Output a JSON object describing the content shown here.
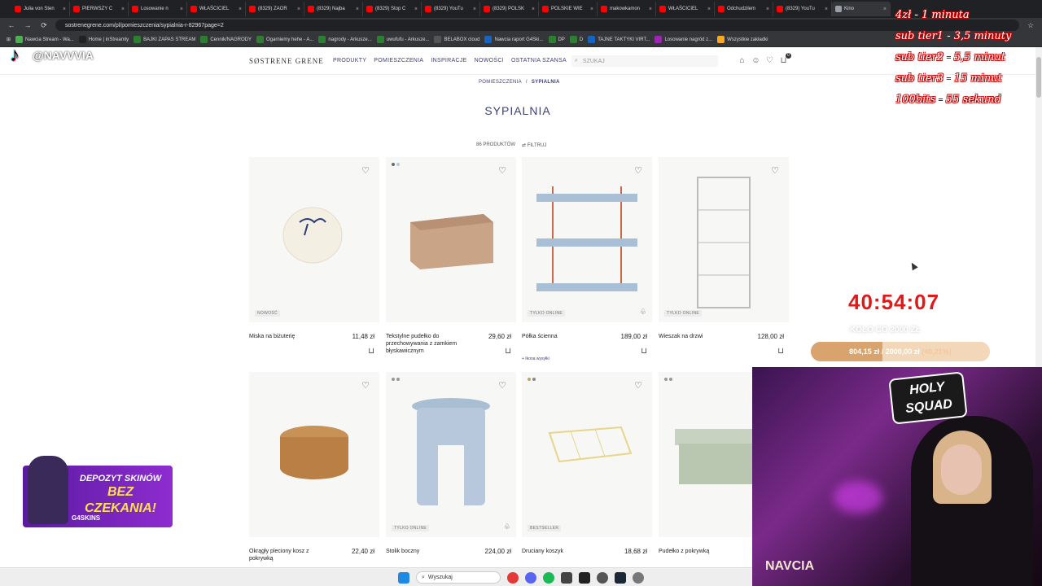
{
  "browser": {
    "tabs": [
      {
        "label": "Julia von Sten",
        "color": "#ff0000"
      },
      {
        "label": "PIERWSZY C",
        "color": "#ff0000"
      },
      {
        "label": "Losowanie n",
        "color": "#ff0000"
      },
      {
        "label": "WŁAŚCICIEL",
        "color": "#ff0000"
      },
      {
        "label": "(8329) ZAOR",
        "color": "#ff0000"
      },
      {
        "label": "(8329) Najba",
        "color": "#ff0000"
      },
      {
        "label": "(8329) Stop C",
        "color": "#ff0000"
      },
      {
        "label": "(8329) YouTu",
        "color": "#ff0000"
      },
      {
        "label": "(8329) POLSK",
        "color": "#ff0000"
      },
      {
        "label": "POLSKIE WIE",
        "color": "#ff0000"
      },
      {
        "label": "makowkamon",
        "color": "#ff0000"
      },
      {
        "label": "WŁAŚCICIEL",
        "color": "#ff0000"
      },
      {
        "label": "Odchudzilem",
        "color": "#ff0000"
      },
      {
        "label": "(8329) YouTu",
        "color": "#ff0000"
      },
      {
        "label": "Kino",
        "color": "#9aa0a6"
      }
    ],
    "url": "sostrenegrene.com/pl/pomieszczenia/sypialnia-r-82967page=2",
    "bookmarks": [
      {
        "label": "Nawcia Stream - Wa...",
        "color": "#4caf50"
      },
      {
        "label": "Home | inStreamly",
        "color": "#222222"
      },
      {
        "label": "BAJKI ZAPAS STREAM",
        "color": "#2e7d32"
      },
      {
        "label": "Cennik/NAGRODY",
        "color": "#2e7d32"
      },
      {
        "label": "Ogarniemy hehe - A...",
        "color": "#2e7d32"
      },
      {
        "label": "nagrody - Arkusze...",
        "color": "#2e7d32"
      },
      {
        "label": "uwufufu - Arkusze...",
        "color": "#2e7d32"
      },
      {
        "label": "BELABOX cloud",
        "color": "#555555"
      },
      {
        "label": "Nawcia raport G4Ski...",
        "color": "#1565c0"
      },
      {
        "label": "DP",
        "color": "#2e7d32"
      },
      {
        "label": "D",
        "color": "#2e7d32"
      },
      {
        "label": "TAJNE TAKTYKI VIRT...",
        "color": "#1565c0"
      },
      {
        "label": "Losowanie nagród z...",
        "color": "#9c27b0"
      },
      {
        "label": "Wszystkie zakładki",
        "color": "#f9a825"
      }
    ]
  },
  "tiktok": {
    "handle": "@NAVVVIA"
  },
  "site": {
    "logo": "SØSTRENE GRENE",
    "nav": [
      "PRODUKTY",
      "POMIESZCZENIA",
      "INSPIRACJE",
      "NOWOŚCI",
      "OSTATNIA SZANSA"
    ],
    "search_placeholder": "SZUKAJ",
    "cart_count": "0",
    "breadcrumb": [
      "POMIESZCZENIA",
      "SYPIALNIA"
    ],
    "title": "SYPIALNIA",
    "product_count": "86 PRODUKTÓW",
    "filter_label": "FILTRUJ",
    "products": [
      {
        "name": "Miska na biżuterię",
        "price": "11,48 zł",
        "badge": "NOWOŚĆ",
        "note": ""
      },
      {
        "name": "Tekstylne pudełko do przechowywania z zamkiem błyskawicznym",
        "price": "29,60 zł",
        "badge": "",
        "note": ""
      },
      {
        "name": "Półka ścienna",
        "price": "189,00 zł",
        "badge": "TYLKO ONLINE",
        "note": "+ Ikona wysyłki"
      },
      {
        "name": "Wieszak na drzwi",
        "price": "128,00 zł",
        "badge": "TYLKO ONLINE",
        "note": ""
      },
      {
        "name": "Okrągły pleciony kosz z pokrywką",
        "price": "22,40 zł",
        "badge": "",
        "note": ""
      },
      {
        "name": "Stolik boczny",
        "price": "224,00 zł",
        "badge": "TYLKO ONLINE",
        "note": ""
      },
      {
        "name": "Druciany koszyk",
        "price": "18,68 zł",
        "badge": "BESTSELLER",
        "note": ""
      },
      {
        "name": "Pudełko z pokrywką",
        "price": "",
        "badge": "",
        "note": ""
      }
    ]
  },
  "overlay": {
    "donation_rules": [
      "4zł - 1 minuta",
      "sub tier1 - 3,5 minuty",
      "sub tier2 - 5,5 minut",
      "sub tier3 - 15 minut",
      "100bits - 55 sekund"
    ],
    "timer": "40:54:07",
    "goal_title": "KOŁO CO 2000 ZŁ",
    "goal_current": "804,15 zł",
    "goal_target": "2000,00 zł",
    "goal_percent": "(40,21%)",
    "goal_fraction": 0.4021,
    "promo_line1": "DEPOZYT SKINÓW",
    "promo_line2": "BEZ CZEKANIA!",
    "promo_brand": "G4SKINS",
    "webcam_logo_line1": "HOLY",
    "webcam_logo_line2": "SQUAD",
    "webcam_name": "NAVCIA"
  },
  "taskbar": {
    "search_label": "Wyszukaj"
  }
}
